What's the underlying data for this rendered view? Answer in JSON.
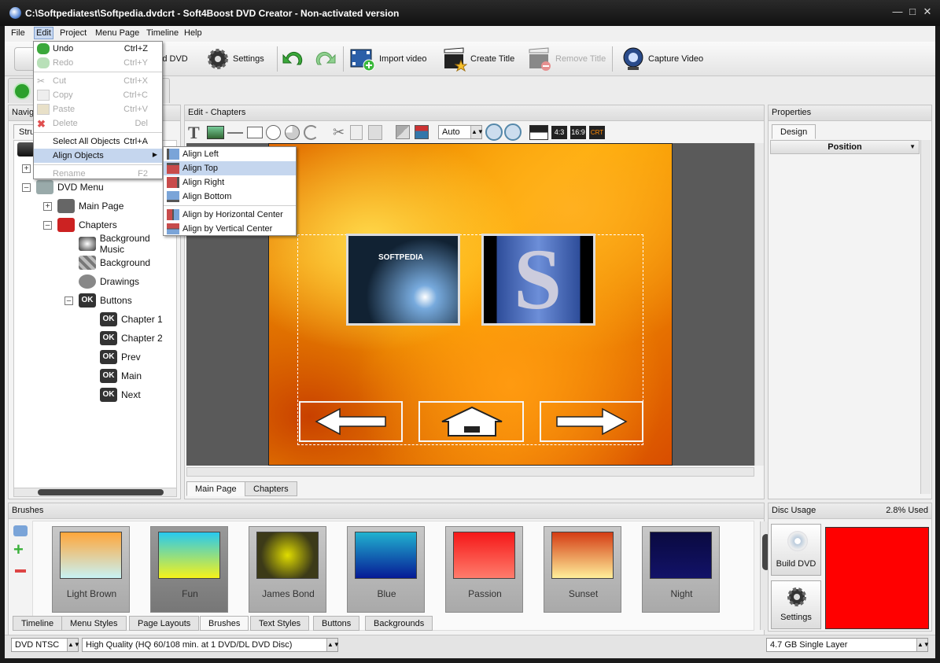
{
  "window": {
    "title": "C:\\Softpediatest\\Softpedia.dvdcrt - Soft4Boost DVD Creator - Non-activated version"
  },
  "menubar": [
    "File",
    "Edit",
    "Project",
    "Menu Page",
    "Timeline",
    "Help"
  ],
  "toolbar": {
    "build_dvd": "Build DVD",
    "settings": "Settings",
    "import_video": "Import video",
    "create_title": "Create Title",
    "remove_title": "Remove Title",
    "capture_video": "Capture Video"
  },
  "edit_menu": [
    {
      "label": "Undo",
      "shortcut": "Ctrl+Z"
    },
    {
      "label": "Redo",
      "shortcut": "Ctrl+Y"
    },
    {
      "label": "Cut",
      "shortcut": "Ctrl+X"
    },
    {
      "label": "Copy",
      "shortcut": "Ctrl+C"
    },
    {
      "label": "Paste",
      "shortcut": "Ctrl+V"
    },
    {
      "label": "Delete",
      "shortcut": "Del"
    },
    {
      "label": "Select All Objects",
      "shortcut": "Ctrl+A"
    },
    {
      "label": "Align Objects",
      "shortcut": ""
    },
    {
      "label": "Rename",
      "shortcut": "F2"
    }
  ],
  "align_submenu": [
    "Align Left",
    "Align Top",
    "Align Right",
    "Align Bottom",
    "Align by Horizontal Center",
    "Align by Vertical Center"
  ],
  "navigator": {
    "title": "Navig",
    "tab": "Stru",
    "tree": [
      "DVD Menu",
      "Main Page",
      "Chapters",
      "Background Music",
      "Background",
      "Drawings",
      "Buttons",
      "Chapter 1",
      "Chapter 2",
      "Prev",
      "Main",
      "Next"
    ],
    "ok_label": "OK"
  },
  "editor": {
    "title": "Edit - Chapters",
    "zoom": "Auto",
    "ratio_43": "4:3",
    "ratio_169": "16:9",
    "crt": "CRT",
    "thumb_text": "SOFTPEDIA",
    "tabs": [
      "Main Page",
      "Chapters"
    ]
  },
  "properties": {
    "title": "Properties",
    "tab": "Design",
    "group": "Position"
  },
  "brushes": {
    "title": "Brushes",
    "items": [
      {
        "label": "Light Brown",
        "c1": "#ffa63a",
        "c2": "#c8f2f4"
      },
      {
        "label": "Fun",
        "c1": "#27c9ef",
        "c2": "#f6f21a"
      },
      {
        "label": "James Bond",
        "c1": "#3c3a18",
        "c2": "#e0dc00"
      },
      {
        "label": "Blue",
        "c1": "#21b2d0",
        "c2": "#061a96"
      },
      {
        "label": "Passion",
        "c1": "#f51818",
        "c2": "#ff7c6c"
      },
      {
        "label": "Sunset",
        "c1": "#d43c14",
        "c2": "#ffef9a"
      },
      {
        "label": "Night",
        "c1": "#0a0a40",
        "c2": "#121268"
      }
    ]
  },
  "bottom_tabs": [
    "Timeline",
    "Menu Styles",
    "Page Layouts",
    "Brushes",
    "Text Styles",
    "Buttons",
    "Backgrounds"
  ],
  "disc": {
    "title": "Disc Usage",
    "used": "2.8% Used",
    "build": "Build DVD",
    "settings": "Settings"
  },
  "status": {
    "format": "DVD NTSC",
    "quality": "High Quality (HQ 60/108 min. at 1 DVD/DL DVD Disc)",
    "disc_type": "4.7 GB Single Layer"
  },
  "colors": {
    "disc_fill": "#ff0000",
    "menu_highlight": "#c5d6ee"
  }
}
